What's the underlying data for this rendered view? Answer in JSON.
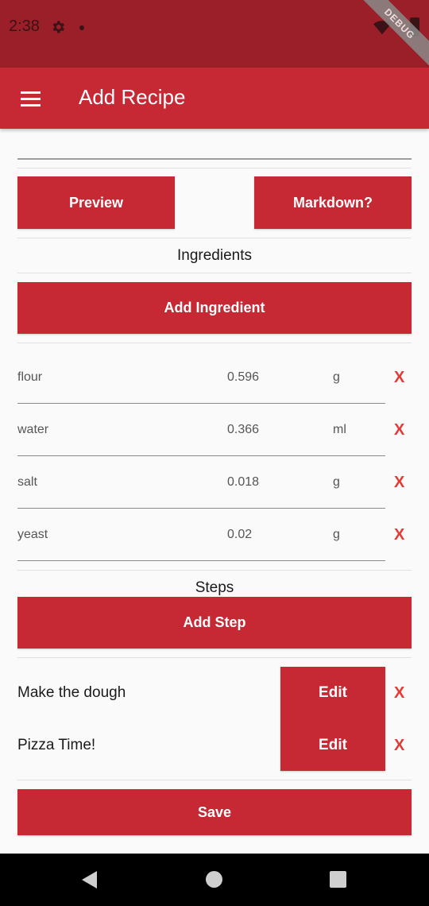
{
  "status": {
    "time": "2:38",
    "debug_label": "DEBUG"
  },
  "app_bar": {
    "title": "Add Recipe"
  },
  "buttons": {
    "preview": "Preview",
    "markdown": "Markdown?",
    "add_ingredient": "Add Ingredient",
    "add_step": "Add Step",
    "save": "Save"
  },
  "sections": {
    "ingredients": "Ingredients",
    "steps": "Steps"
  },
  "ingredients": [
    {
      "name": "flour",
      "qty": "0.596",
      "unit": "g"
    },
    {
      "name": "water",
      "qty": "0.366",
      "unit": "ml"
    },
    {
      "name": "salt",
      "qty": "0.018",
      "unit": "g"
    },
    {
      "name": "yeast",
      "qty": "0.02",
      "unit": "g"
    }
  ],
  "steps": [
    {
      "name": "Make the dough",
      "edit": "Edit"
    },
    {
      "name": "Pizza Time!",
      "edit": "Edit"
    }
  ],
  "delete_symbol": "X",
  "colors": {
    "primary": "#c62834",
    "status_bar": "#9b1f28",
    "delete": "#e53935"
  },
  "icons": [
    "settings-icon",
    "notification-dot",
    "wifi-icon",
    "battery-icon",
    "menu-icon",
    "back-icon",
    "home-icon",
    "recents-icon"
  ]
}
